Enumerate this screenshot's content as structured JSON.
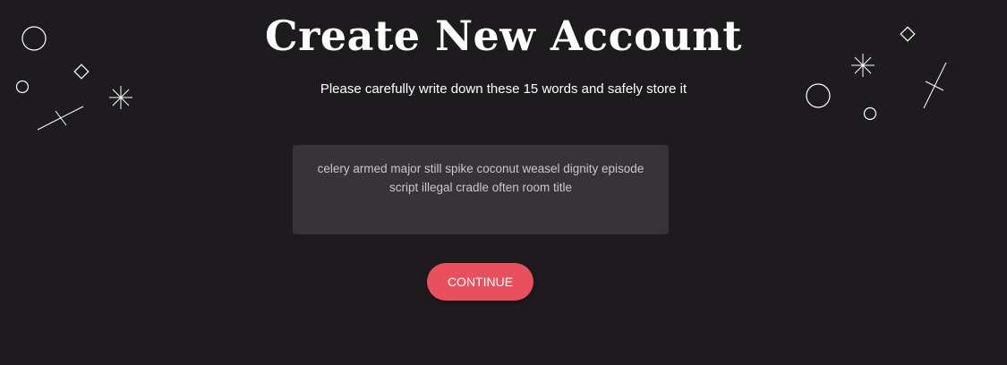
{
  "header": {
    "title": "Create New Account",
    "subtitle": "Please carefully write down these 15 words and safely store it"
  },
  "seed_phrase": {
    "text": "celery armed major still spike coconut weasel dignity episode script illegal cradle often room title"
  },
  "actions": {
    "continue_label": "CONTINUE"
  },
  "colors": {
    "background": "#1e1b1f",
    "phrase_box": "#363437",
    "accent": "#e8505e"
  },
  "decorations": [
    "circle-icon",
    "diamond-icon",
    "sparkle-icon",
    "line-icon"
  ]
}
